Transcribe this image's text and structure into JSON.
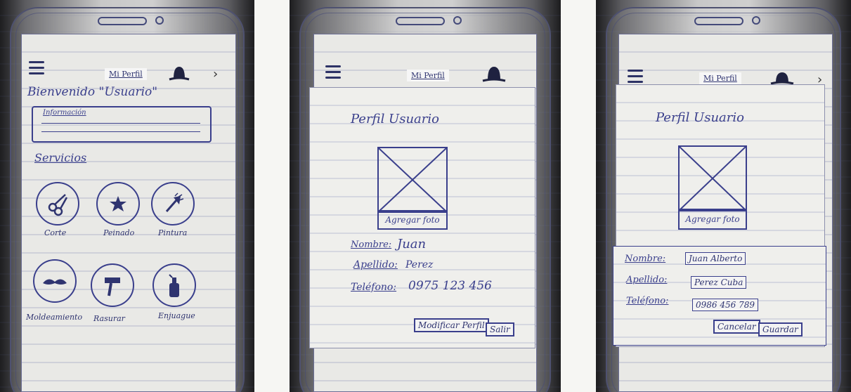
{
  "screens": {
    "home": {
      "header_title": "Mi Perfil",
      "welcome": "Bienvenido \"Usuario\"",
      "info_label": "Información",
      "services_title": "Servicios",
      "services": [
        {
          "label": "Corte",
          "icon": "scissors-icon"
        },
        {
          "label": "Peinado",
          "icon": "star-icon"
        },
        {
          "label": "Pintura",
          "icon": "brush-icon"
        },
        {
          "label": "Moldeamiento",
          "icon": "mustache-icon"
        },
        {
          "label": "Rasurar",
          "icon": "razor-icon"
        },
        {
          "label": "Enjuague",
          "icon": "bottle-icon"
        }
      ]
    },
    "profile_view": {
      "header_title": "Mi Perfil",
      "title": "Perfil Usuario",
      "photo_label": "Agregar foto",
      "name_label": "Nombre:",
      "name_value": "Juan",
      "surname_label": "Apellido:",
      "surname_value": "Perez",
      "phone_label": "Teléfono:",
      "phone_value": "0975 123 456",
      "modify_button": "Modificar Perfil",
      "exit_button": "Salir"
    },
    "profile_edit": {
      "header_title": "Mi Perfil",
      "title": "Perfil Usuario",
      "photo_label": "Agregar foto",
      "name_label": "Nombre:",
      "name_value": "Juan Alberto",
      "surname_label": "Apellido:",
      "surname_value": "Perez Cuba",
      "phone_label": "Teléfono:",
      "phone_value": "0986 456 789",
      "cancel_button": "Cancelar",
      "save_button": "Guardar"
    }
  },
  "colors": {
    "ink": "#3a3f8c",
    "paper": "#e9e9e6",
    "background": "#f6f6f3"
  }
}
